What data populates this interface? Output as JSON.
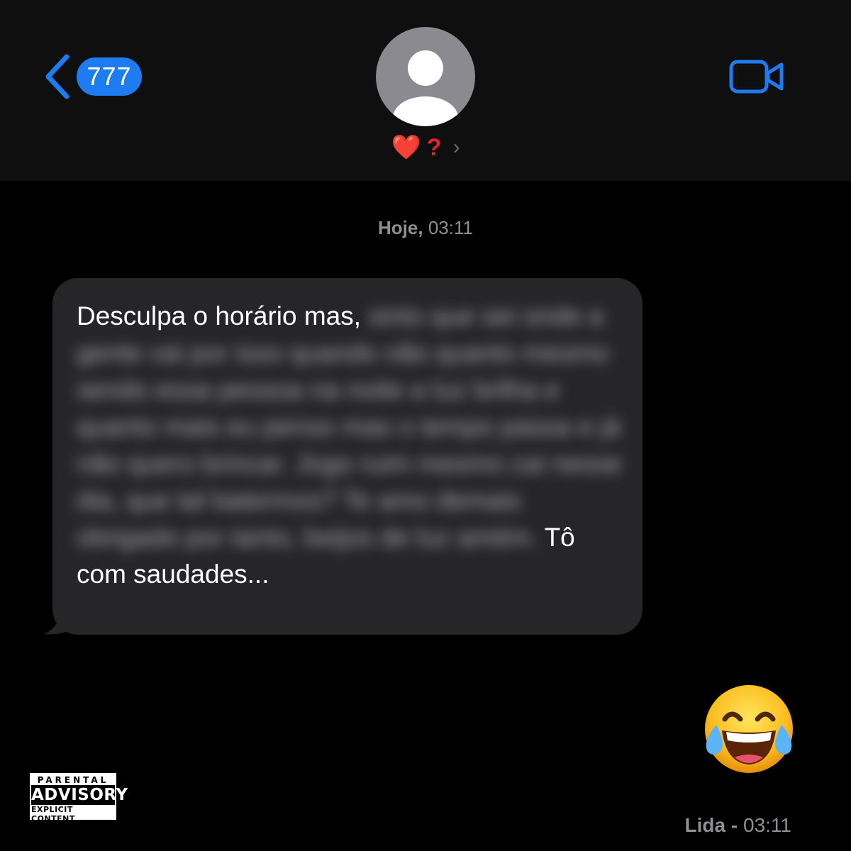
{
  "header": {
    "back_badge": "777",
    "contact_heart": "❤️",
    "contact_mark": "?",
    "contact_chevron": "›",
    "icons": {
      "back": "chevron-left-icon",
      "video": "video-camera-icon",
      "avatar": "person-silhouette-icon"
    },
    "colors": {
      "accent": "#1e7cf2",
      "header_bg": "#0f0f0f",
      "avatar_bg": "#8a8a90"
    }
  },
  "conversation": {
    "timestamp_day": "Hoje,",
    "timestamp_time": "03:11",
    "message": {
      "visible_start": "Desculpa o horário mas,",
      "blurred_text": "sinto que sei onde a gente vai por isso quando não quanto mesmo sendo essa pessoa na noite a luz brilha e quanto mais eu penso mas o tempo passa e já não quero brincar. Jogo ruim mesmo cai nesse dia, que tal batermos? Te amo demais obrigado por tanto, beijos de luz amém.",
      "visible_end": "Tô com saudades..."
    },
    "reply_emoji": "face-with-tears-of-joy",
    "read_label": "Lida -",
    "read_time": "03:11"
  },
  "advisory": {
    "top": "PARENTAL",
    "middle": "ADVISORY",
    "bottom": "EXPLICIT CONTENT"
  }
}
